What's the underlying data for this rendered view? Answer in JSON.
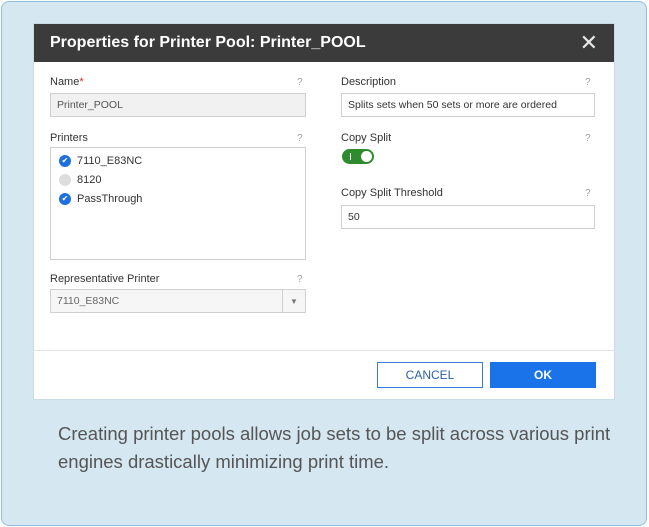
{
  "dialog": {
    "title": "Properties for Printer Pool: Printer_POOL",
    "close_glyph": "✕"
  },
  "name": {
    "label": "Name",
    "required_mark": "*",
    "help": "?",
    "value": "Printer_POOL"
  },
  "description": {
    "label": "Description",
    "help": "?",
    "value": "Splits sets when 50 sets or more are ordered"
  },
  "printers": {
    "label": "Printers",
    "help": "?",
    "items": [
      {
        "label": "7110_E83NC",
        "checked": true
      },
      {
        "label": "8120",
        "checked": false
      },
      {
        "label": "PassThrough",
        "checked": true
      }
    ]
  },
  "copy_split": {
    "label": "Copy Split",
    "help": "?",
    "enabled": true
  },
  "copy_split_threshold": {
    "label": "Copy Split Threshold",
    "help": "?",
    "value": "50"
  },
  "representative_printer": {
    "label": "Representative Printer",
    "help": "?",
    "value": "7110_E83NC",
    "arrow": "▼"
  },
  "buttons": {
    "cancel": "CANCEL",
    "ok": "OK"
  },
  "caption": "Creating printer pools allows job sets to be split across various print engines drastically minimizing print time.",
  "colors": {
    "accent": "#1a73e8",
    "toggle_on": "#2e8b2e",
    "titlebar": "#3b3b3b",
    "frame": "#d5e7f1"
  },
  "icons": {
    "checked": "check-circle-icon",
    "unchecked": "empty-circle-icon",
    "dropdown": "chevron-down-icon",
    "close": "close-icon"
  }
}
